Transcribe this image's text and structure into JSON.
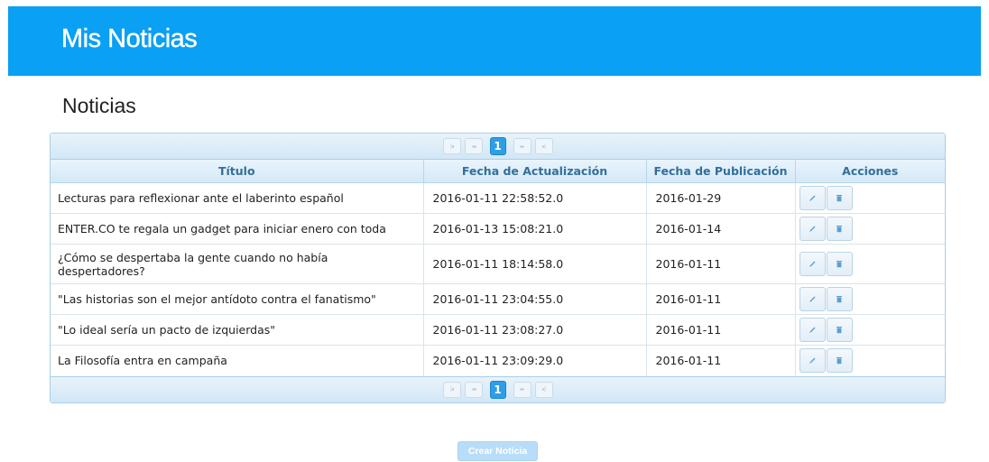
{
  "header": {
    "title": "Mis Noticias"
  },
  "page": {
    "heading": "Noticias"
  },
  "paginator": {
    "first_icon": "first-page-icon",
    "prev_icon": "previous-page-icon",
    "next_icon": "next-page-icon",
    "last_icon": "last-page-icon",
    "first_glyph": "|◂",
    "prev_glyph": "◂◂",
    "next_glyph": "▸▸",
    "last_glyph": "▸|",
    "current_page": "1"
  },
  "table": {
    "columns": [
      "Título",
      "Fecha de Actualización",
      "Fecha de Publicación",
      "Acciones"
    ],
    "rows": [
      {
        "titulo": "Lecturas para reflexionar ante el laberinto español",
        "actualizacion": "2016-01-11 22:58:52.0",
        "publicacion": "2016-01-29"
      },
      {
        "titulo": "ENTER.CO te regala un gadget para iniciar enero con toda",
        "actualizacion": "2016-01-13 15:08:21.0",
        "publicacion": "2016-01-14"
      },
      {
        "titulo": "¿Cómo se despertaba la gente cuando no había despertadores?",
        "actualizacion": "2016-01-11 18:14:58.0",
        "publicacion": "2016-01-11"
      },
      {
        "titulo": "\"Las historias son el mejor antídoto contra el fanatismo\"",
        "actualizacion": "2016-01-11 23:04:55.0",
        "publicacion": "2016-01-11"
      },
      {
        "titulo": "\"Lo ideal sería un pacto de izquierdas\"",
        "actualizacion": "2016-01-11 23:08:27.0",
        "publicacion": "2016-01-11"
      },
      {
        "titulo": "La Filosofía entra en campaña",
        "actualizacion": "2016-01-11 23:09:29.0",
        "publicacion": "2016-01-11"
      }
    ],
    "action_icons": {
      "edit": "pencil-icon",
      "delete": "trash-icon"
    }
  },
  "footer": {
    "create_label": "Crear Noticia"
  },
  "colors": {
    "header_bg": "#0aa0f3",
    "accent": "#2d9fe6",
    "header_text": "#336f9a"
  }
}
